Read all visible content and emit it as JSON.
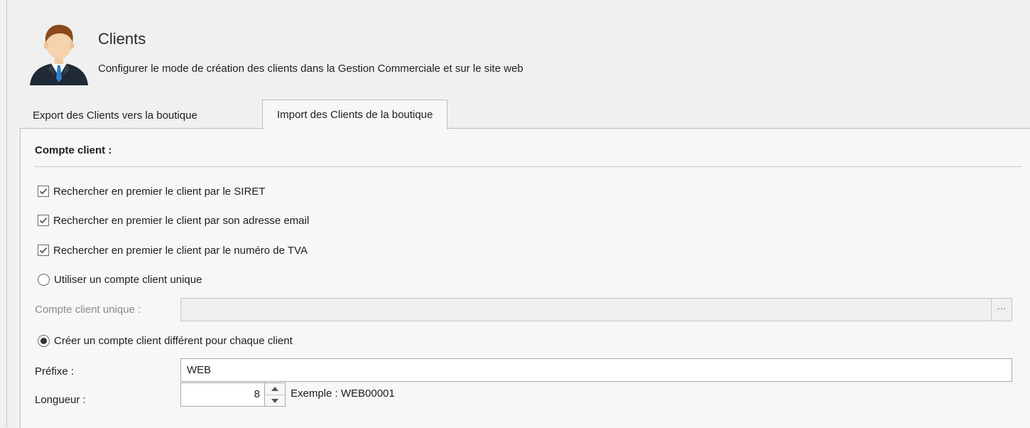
{
  "header": {
    "title": "Clients",
    "subtitle": "Configurer le mode de création des clients dans la Gestion Commerciale et sur le site web",
    "icon": "client-user-icon"
  },
  "tabs": [
    {
      "label": "Export des Clients vers la boutique",
      "active": false
    },
    {
      "label": "Import des Clients de la boutique",
      "active": true
    }
  ],
  "panel": {
    "section_title": "Compte client :",
    "options": {
      "siret": {
        "label": "Rechercher en premier le client par le SIRET",
        "checked": true
      },
      "email": {
        "label": "Rechercher en premier le client par son adresse email",
        "checked": true
      },
      "tva": {
        "label": "Rechercher en premier le client par le numéro de TVA",
        "checked": true
      }
    },
    "radio_unique": {
      "label": "Utiliser un compte client unique",
      "selected": false
    },
    "compte_unique": {
      "label": "Compte client unique :",
      "value": "",
      "button_label": "···"
    },
    "radio_different": {
      "label": "Créer un compte client différent pour chaque client",
      "selected": true
    },
    "prefixe": {
      "label": "Préfixe :",
      "value": "WEB"
    },
    "longueur": {
      "label": "Longueur :",
      "value": "8",
      "example": "Exemple : WEB00001"
    }
  },
  "colors": {
    "background": "#f0f0f0",
    "panel": "#f7f7f7",
    "border": "#bdbdbd",
    "disabled_text": "#8a8a8a"
  }
}
